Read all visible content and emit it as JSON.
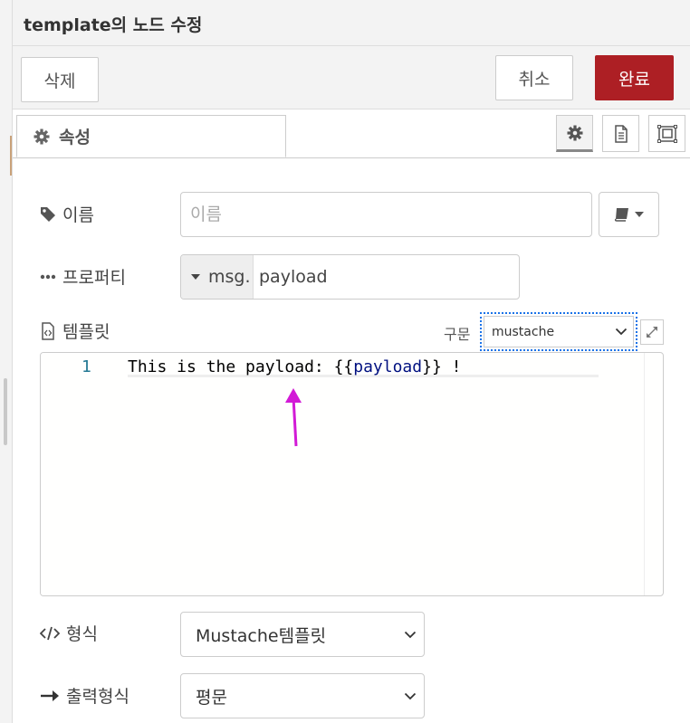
{
  "header": {
    "title": "template의 노드 수정"
  },
  "toolbar": {
    "delete_label": "삭제",
    "cancel_label": "취소",
    "done_label": "완료"
  },
  "tabs": {
    "properties_label": "속성"
  },
  "form": {
    "name_label": "이름",
    "name_placeholder": "이름",
    "name_value": "",
    "property_label": "프로퍼티",
    "property_type": "msg.",
    "property_value": "payload",
    "template_label": "템플릿",
    "syntax_label": "구문",
    "syntax_value": "mustache",
    "format_label": "형식",
    "format_value": "Mustache템플릿",
    "output_label": "출력형식",
    "output_value": "평문"
  },
  "editor": {
    "line_number": "1",
    "code_prefix": "This is the payload: {{",
    "code_var": "payload",
    "code_suffix": "}} !"
  },
  "colors": {
    "done_button": "#ad1f24",
    "annotation_arrow": "#d21ad6",
    "focus_outline": "#1a73e8"
  }
}
